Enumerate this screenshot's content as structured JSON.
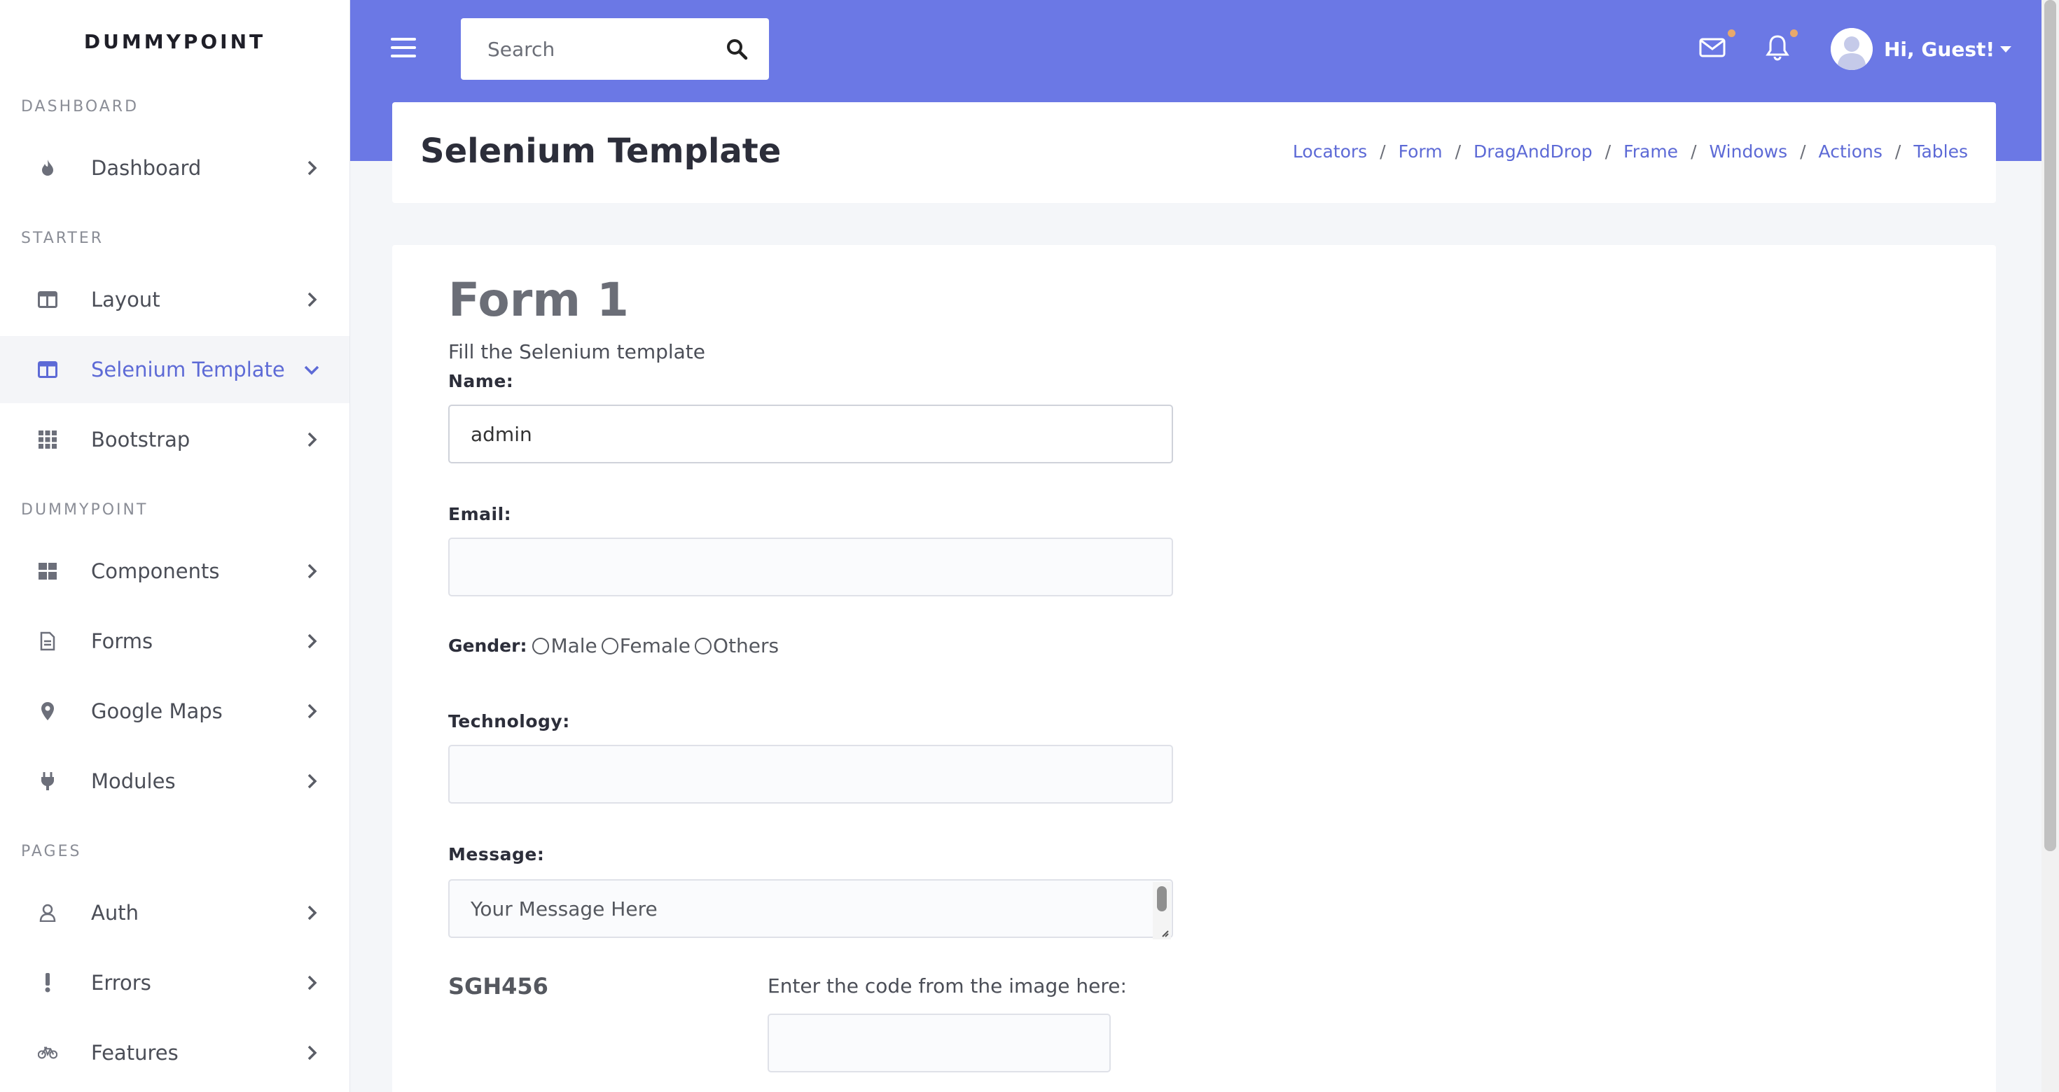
{
  "brand": "DUMMYPOINT",
  "sidebar": {
    "sections": [
      "DASHBOARD",
      "STARTER",
      "DUMMYPOINT",
      "PAGES"
    ],
    "items": [
      {
        "label": "Dashboard",
        "icon": "flame-icon"
      },
      {
        "label": "Layout",
        "icon": "layout-icon"
      },
      {
        "label": "Selenium Template",
        "icon": "layout-icon",
        "active": true
      },
      {
        "label": "Bootstrap",
        "icon": "grid-icon"
      },
      {
        "label": "Components",
        "icon": "components-icon"
      },
      {
        "label": "Forms",
        "icon": "document-icon"
      },
      {
        "label": "Google Maps",
        "icon": "map-pin-icon"
      },
      {
        "label": "Modules",
        "icon": "plug-icon"
      },
      {
        "label": "Auth",
        "icon": "user-icon"
      },
      {
        "label": "Errors",
        "icon": "exclamation-icon"
      },
      {
        "label": "Features",
        "icon": "bicycle-icon"
      }
    ]
  },
  "topbar": {
    "search_placeholder": "Search",
    "user_greeting": "Hi, Guest!",
    "accent_color": "#6b78e5"
  },
  "header": {
    "title": "Selenium Template",
    "breadcrumb": [
      "Locators",
      "Form",
      "DragAndDrop",
      "Frame",
      "Windows",
      "Actions",
      "Tables"
    ]
  },
  "form": {
    "title": "Form 1",
    "subtitle": "Fill the Selenium template",
    "name_label": "Name:",
    "name_value": "admin",
    "email_label": "Email:",
    "gender_label": "Gender:",
    "gender_options": [
      "Male",
      "Female",
      "Others"
    ],
    "technology_label": "Technology:",
    "message_label": "Message:",
    "message_placeholder": "Your Message Here",
    "captcha_code": "SGH456",
    "captcha_label": "Enter the code from the image here:"
  }
}
